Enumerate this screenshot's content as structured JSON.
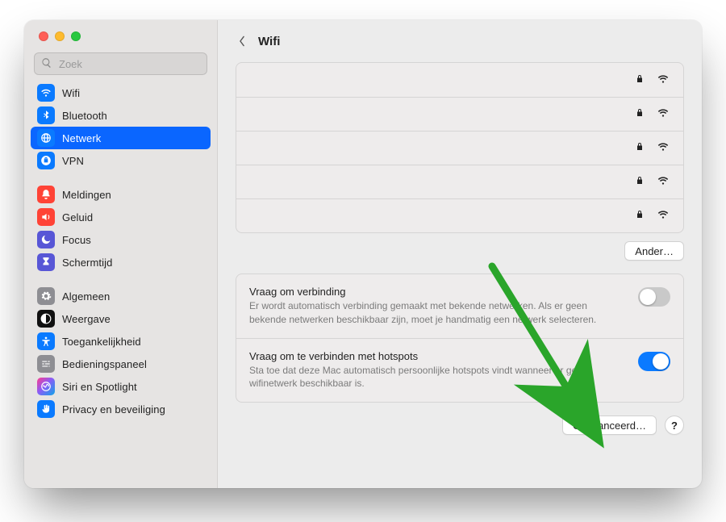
{
  "window": {
    "page_title": "Wifi",
    "search_placeholder": "Zoek"
  },
  "sidebar": {
    "groups": [
      {
        "items": [
          {
            "key": "wifi",
            "label": "Wifi",
            "icon": "wifi",
            "icon_bg": "blue"
          },
          {
            "key": "bluetooth",
            "label": "Bluetooth",
            "icon": "bluetooth",
            "icon_bg": "blue"
          },
          {
            "key": "netwerk",
            "label": "Netwerk",
            "icon": "globe",
            "icon_bg": "blue",
            "selected": true
          },
          {
            "key": "vpn",
            "label": "VPN",
            "icon": "vpn",
            "icon_bg": "blue"
          }
        ]
      },
      {
        "items": [
          {
            "key": "meldingen",
            "label": "Meldingen",
            "icon": "bell",
            "icon_bg": "red"
          },
          {
            "key": "geluid",
            "label": "Geluid",
            "icon": "speaker",
            "icon_bg": "red"
          },
          {
            "key": "focus",
            "label": "Focus",
            "icon": "moon",
            "icon_bg": "indigo"
          },
          {
            "key": "schermtijd",
            "label": "Schermtijd",
            "icon": "hourglass",
            "icon_bg": "indigo"
          }
        ]
      },
      {
        "items": [
          {
            "key": "algemeen",
            "label": "Algemeen",
            "icon": "gear",
            "icon_bg": "grey"
          },
          {
            "key": "weergave",
            "label": "Weergave",
            "icon": "theme",
            "icon_bg": "black"
          },
          {
            "key": "toegankelijkheid",
            "label": "Toegankelijkheid",
            "icon": "access",
            "icon_bg": "blue"
          },
          {
            "key": "bediening",
            "label": "Bedieningspaneel",
            "icon": "sliders",
            "icon_bg": "grey"
          },
          {
            "key": "siri",
            "label": "Siri en Spotlight",
            "icon": "siri",
            "icon_bg": "multi"
          },
          {
            "key": "privacy",
            "label": "Privacy en beveiliging",
            "icon": "hand",
            "icon_bg": "blue"
          }
        ]
      }
    ]
  },
  "network_list": {
    "count": 5
  },
  "buttons": {
    "other": "Ander…",
    "advanced": "Geavanceerd…",
    "help": "?"
  },
  "options": [
    {
      "key": "ask_join",
      "title": "Vraag om verbinding",
      "desc": "Er wordt automatisch verbinding gemaakt met bekende netwerken. Als er geen bekende netwerken beschikbaar zijn, moet je handmatig een netwerk selecteren.",
      "on": false
    },
    {
      "key": "ask_hotspot",
      "title": "Vraag om te verbinden met hotspots",
      "desc": "Sta toe dat deze Mac automatisch persoonlijke hotspots vindt wanneer er geen wifinetwerk beschikbaar is.",
      "on": true
    }
  ]
}
